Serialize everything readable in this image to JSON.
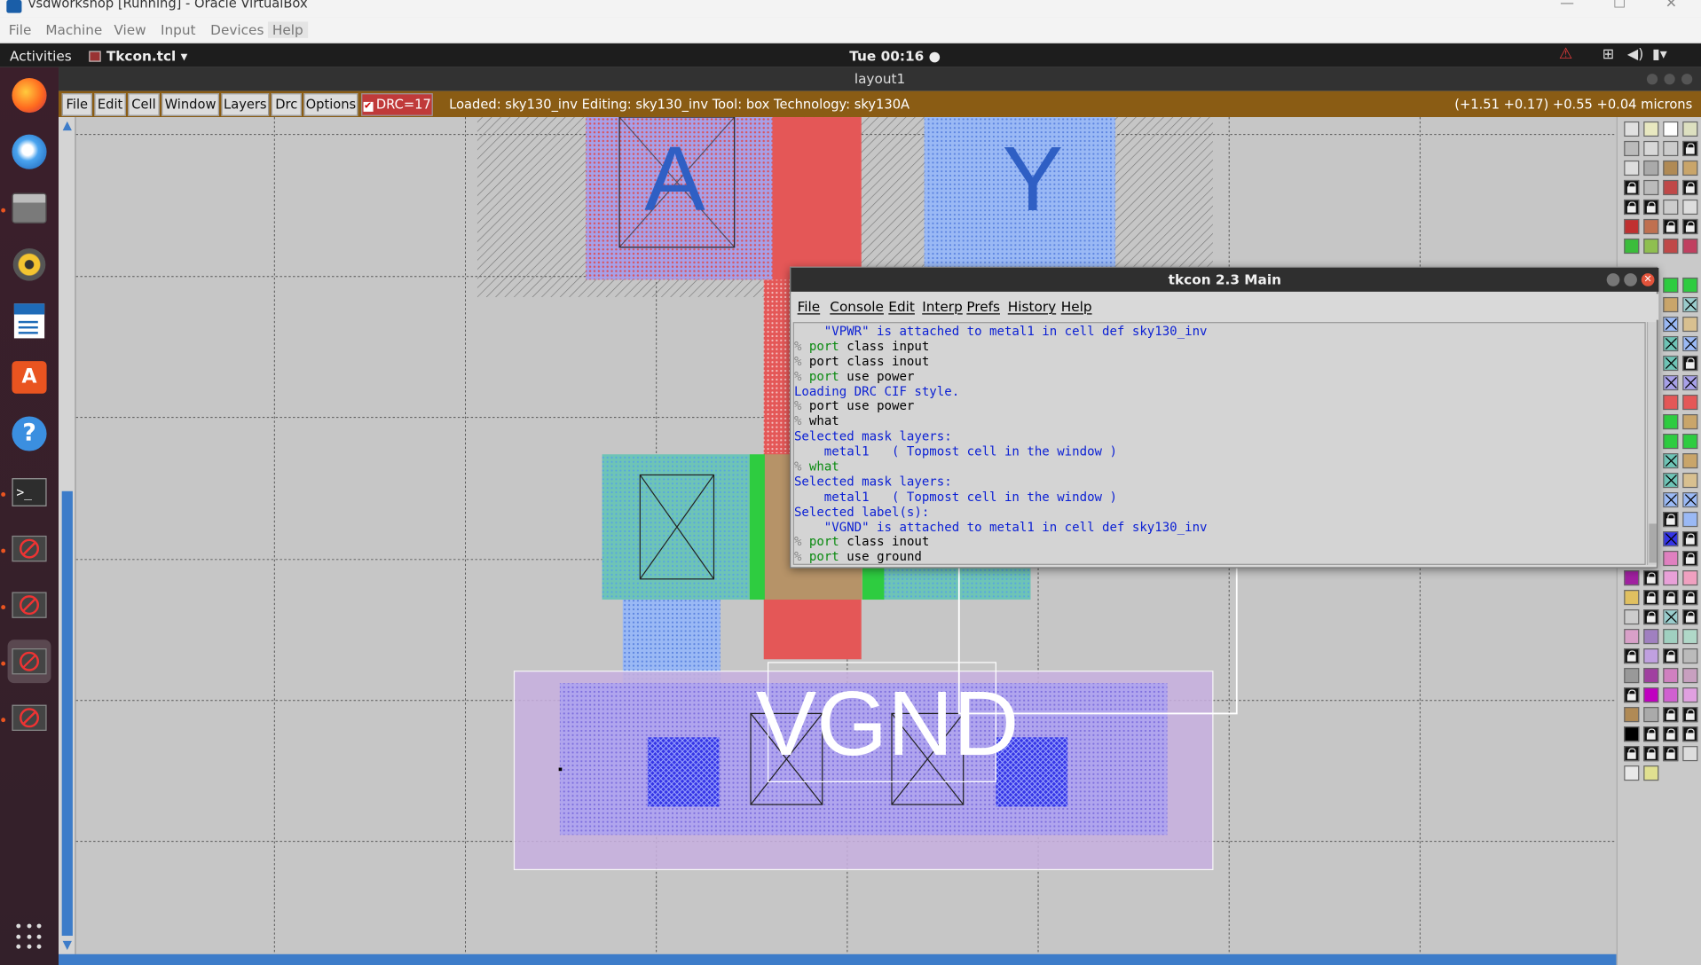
{
  "vbox": {
    "title": "vsdworkshop [Running] - Oracle VirtualBox",
    "menu": [
      "File",
      "Machine",
      "View",
      "Input",
      "Devices",
      "Help"
    ]
  },
  "topbar": {
    "activities": "Activities",
    "app_name": "Tkcon.tcl ▾",
    "clock": "Tue 00:16 ●"
  },
  "dock": {
    "items": [
      "firefox-icon",
      "thunderbird-icon",
      "files-icon",
      "rhythmbox-icon",
      "writer-icon",
      "software-icon",
      "help-icon",
      "terminal-icon",
      "unavailable-app-icon",
      "unavailable-app-icon",
      "unavailable-app-icon",
      "unavailable-app-icon",
      "show-apps-icon"
    ]
  },
  "magic": {
    "window_title": "layout1",
    "menu": [
      "File",
      "Edit",
      "Cell",
      "Window",
      "Layers",
      "Drc",
      "Options"
    ],
    "drc_label": "DRC=17",
    "drc_checked": true,
    "status": "Loaded: sky130_inv Editing: sky130_inv Tool: box  Technology: sky130A",
    "coords": "(+1.51 +0.17) +0.55 +0.04 microns",
    "labels": {
      "a": "A",
      "y": "Y",
      "vgnd": "VGND"
    },
    "colors": {
      "bar": "#8a5c14",
      "drc": "#c03a3a",
      "scroll": "#3d7cc9"
    }
  },
  "tkcon": {
    "title": "tkcon 2.3 Main",
    "menu": [
      "File",
      "Console",
      "Edit",
      "Interp",
      "Prefs",
      "History",
      "Help"
    ],
    "lines": [
      {
        "type": "out",
        "text": "    \"VPWR\" is attached to metal1 in cell def sky130_inv"
      },
      {
        "type": "cmd",
        "kw": "port",
        "text": " class input"
      },
      {
        "type": "cmd",
        "kw": "",
        "text": "port class inout"
      },
      {
        "type": "cmd",
        "kw": "port",
        "text": " use power"
      },
      {
        "type": "out",
        "text": "Loading DRC CIF style."
      },
      {
        "type": "cmd",
        "kw": "",
        "text": "port use power"
      },
      {
        "type": "cmd",
        "kw": "",
        "text": "what"
      },
      {
        "type": "out",
        "text": "Selected mask layers:"
      },
      {
        "type": "out",
        "text": "    metal1   ( Topmost cell in the window )"
      },
      {
        "type": "cmd",
        "kw": "what",
        "text": ""
      },
      {
        "type": "out",
        "text": "Selected mask layers:"
      },
      {
        "type": "out",
        "text": "    metal1   ( Topmost cell in the window )"
      },
      {
        "type": "out",
        "text": "Selected label(s):"
      },
      {
        "type": "out",
        "text": "    \"VGND\" is attached to metal1 in cell def sky130_inv"
      },
      {
        "type": "cmd",
        "kw": "port",
        "text": " class inout"
      },
      {
        "type": "cmd",
        "kw": "port",
        "text": " use ground"
      }
    ]
  }
}
